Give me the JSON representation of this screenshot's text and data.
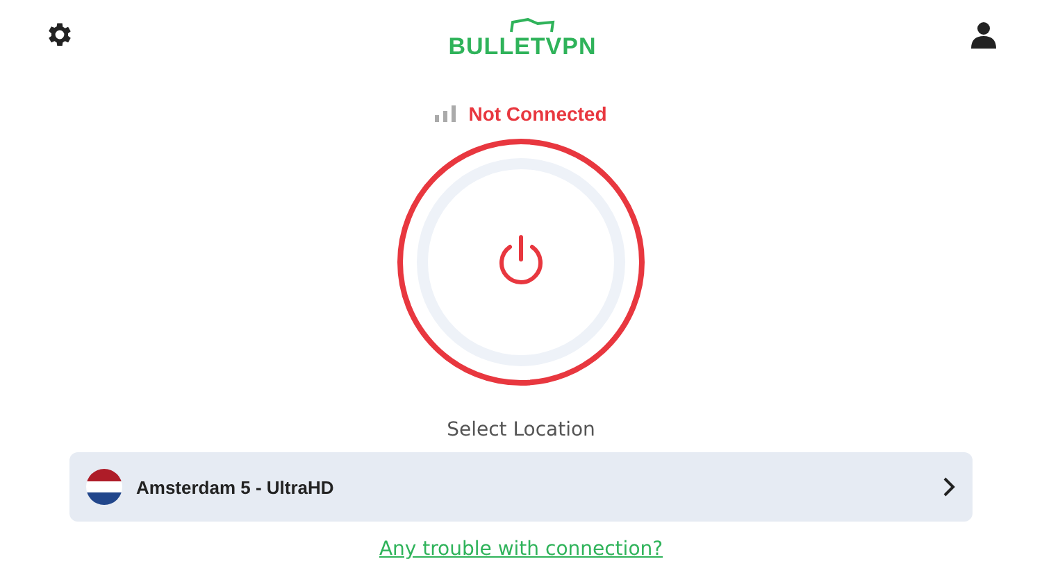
{
  "header": {
    "logo": "BULLETVPN"
  },
  "status": {
    "connected": false,
    "label": "Not Connected"
  },
  "select_label": "Select Location",
  "location": {
    "name": "Amsterdam 5 - UltraHD"
  },
  "help_link": "Any trouble with connection?"
}
